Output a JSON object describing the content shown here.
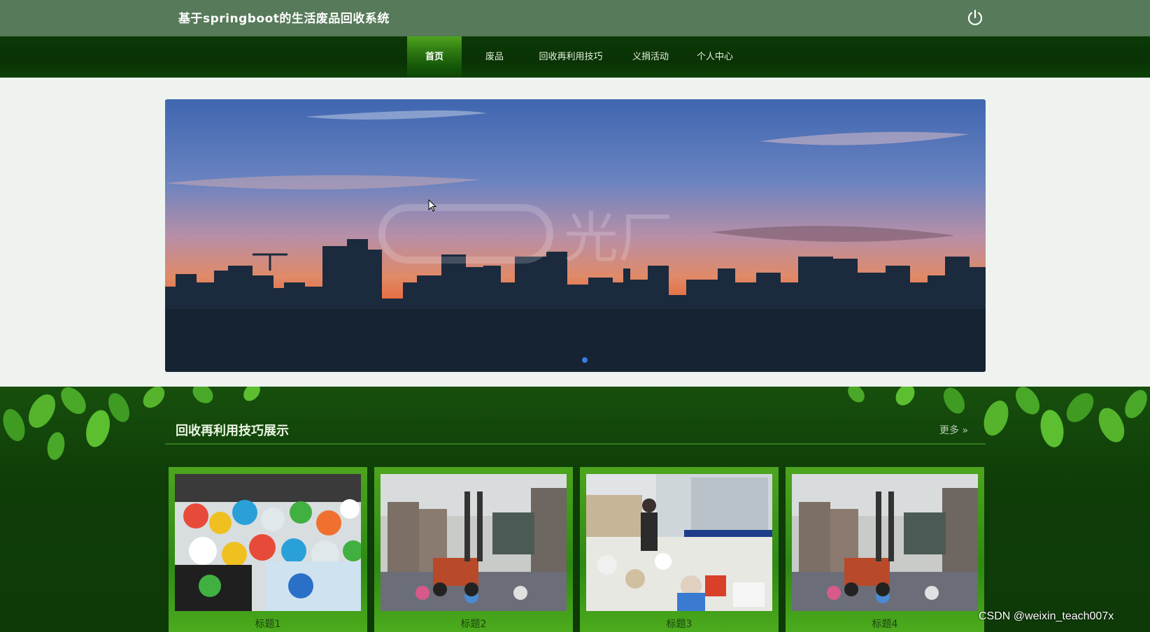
{
  "header": {
    "site_title": "基于springboot的生活废品回收系统",
    "power_icon": "power-icon"
  },
  "nav": {
    "items": [
      {
        "label": "首页",
        "active": true
      },
      {
        "label": "废品",
        "active": false
      },
      {
        "label": "回收再利用技巧",
        "active": false
      },
      {
        "label": "义捐活动",
        "active": false
      },
      {
        "label": "个人中心",
        "active": false
      }
    ]
  },
  "banner": {
    "watermark_text": "光厂",
    "image": "city-skyline-sunset"
  },
  "section": {
    "title": "回收再利用技巧展示",
    "more_label": "更多",
    "more_icon": "double-chevron-right-icon"
  },
  "cards": [
    {
      "label": "标题1",
      "image": "plastic-bottles-pile"
    },
    {
      "label": "标题2",
      "image": "forklift-recycling-yard"
    },
    {
      "label": "标题3",
      "image": "worker-sorting-waste"
    },
    {
      "label": "标题4",
      "image": "forklift-recycling-yard"
    }
  ],
  "overlay": {
    "watermark": "CSDN @weixin_teach007x"
  },
  "colors": {
    "topbar": "#577a5a",
    "nav_bg": "#0b3a06",
    "nav_active": "#3f8f18",
    "banner_band": "#eef3ef",
    "lower_bg": "#0f3d08",
    "card_frame": "#3f9a18"
  }
}
